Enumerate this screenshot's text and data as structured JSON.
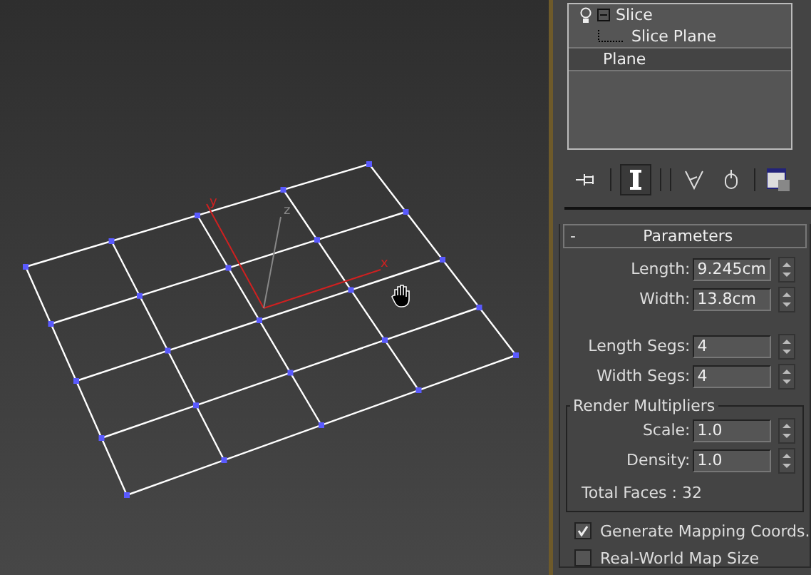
{
  "viewport": {
    "axes": [
      {
        "kind": "x",
        "label": "x"
      },
      {
        "kind": "y",
        "label": "y"
      },
      {
        "kind": "z",
        "label": "z"
      }
    ]
  },
  "modifier_stack": {
    "items": [
      {
        "label": "Slice",
        "selected": false,
        "expanded": true,
        "children": [
          {
            "label": "Slice Plane",
            "selected": false
          }
        ]
      },
      {
        "label": "Plane",
        "selected": true
      }
    ]
  },
  "toolbar": [
    {
      "kind": "pin",
      "selected": false
    },
    {
      "kind": "ibar",
      "selected": true
    },
    {
      "kind": "fork",
      "selected": false
    },
    {
      "kind": "bulb",
      "selected": false
    },
    {
      "kind": "config",
      "selected": false
    }
  ],
  "parameters": {
    "collapse": "-",
    "title": "Parameters",
    "fields": [
      {
        "label": "Length:",
        "value": "9.245cm"
      },
      {
        "label": "Width:",
        "value": "13.8cm"
      }
    ],
    "seg_fields": [
      {
        "label": "Length Segs:",
        "value": "4"
      },
      {
        "label": "Width Segs:",
        "value": "4"
      }
    ],
    "render_multipliers": {
      "title": "Render Multipliers",
      "fields": [
        {
          "label": "Scale:",
          "value": "1.0"
        },
        {
          "label": "Density:",
          "value": "1.0"
        }
      ],
      "total": "Total Faces : 32"
    },
    "checkboxes": [
      {
        "label": "Generate Mapping Coords.",
        "checked": true
      },
      {
        "label": "Real-World Map Size",
        "checked": false
      }
    ]
  }
}
